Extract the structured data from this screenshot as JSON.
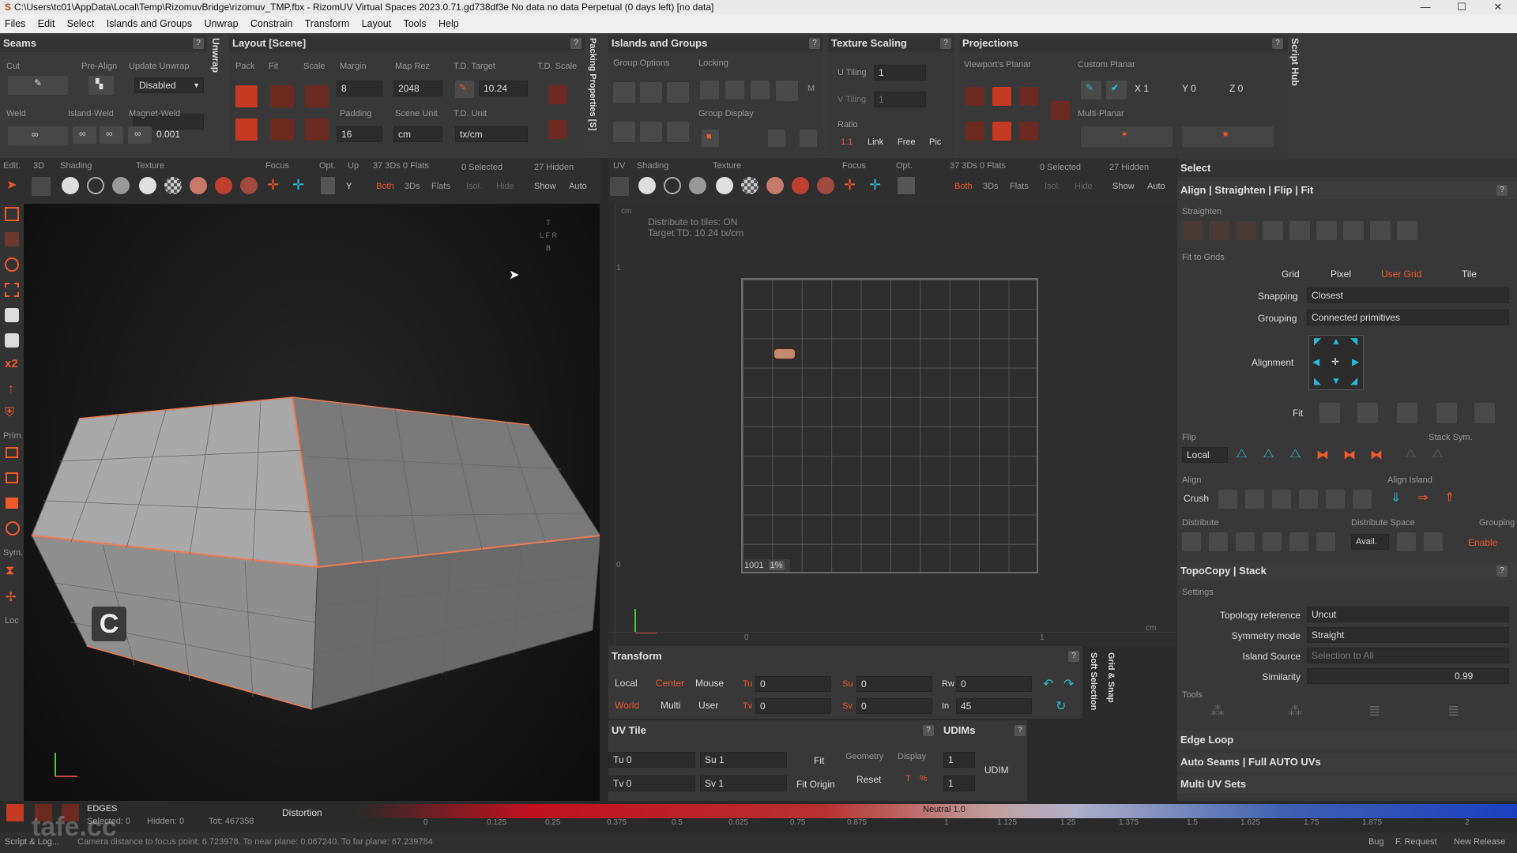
{
  "window": {
    "title": "C:\\Users\\tc01\\AppData\\Local\\Temp\\RizomuvBridge\\rizomuv_TMP.fbx - RizomUV  Virtual Spaces 2023.0.71.gd738df3e No data no data Perpetual  (0 days left) [no data]",
    "minimize": "—",
    "maximize": "☐",
    "close": "✕"
  },
  "menu": [
    "Files",
    "Edit",
    "Select",
    "Islands and Groups",
    "Unwrap",
    "Constrain",
    "Transform",
    "Layout",
    "Tools",
    "Help"
  ],
  "seams": {
    "title": "Seams",
    "help": "?",
    "cut": "Cut",
    "pre_align": "Pre-Align",
    "update_unwrap": "Update Unwrap",
    "update_value": "Disabled",
    "weld": "Weld",
    "island_weld": "Island-Weld",
    "magnet_weld": "Magnet-Weld",
    "magnet_value": "0.001"
  },
  "unwrap_tab": "Unwrap",
  "layout": {
    "title": "Layout [Scene]",
    "help": "?",
    "pack": "Pack",
    "fit": "Fit",
    "scale": "Scale",
    "margin": "Margin",
    "margin_value": "8",
    "map_rez": "Map Rez",
    "map_rez_value": "2048",
    "td_target": "T.D. Target",
    "td_target_value": "10.24",
    "td_scale": "T.D. Scale",
    "padding": "Padding",
    "padding_value": "16",
    "scene_unit": "Scene Unit",
    "scene_unit_value": "cm",
    "td_unit": "T.D. Unit",
    "td_unit_value": "tx/cm"
  },
  "packing_tab": "Packing Properties [S]",
  "islands": {
    "title": "Islands and Groups",
    "help": "?",
    "group_options": "Group Options",
    "locking": "Locking",
    "group_display": "Group Display",
    "m": "M"
  },
  "texture_scaling": {
    "title": "Texture Scaling",
    "help": "?",
    "u_tiling": "U Tiling",
    "u_value": "1",
    "v_tiling": "V Tiling",
    "v_value": "1",
    "ratio": "Ratio",
    "r11": "1:1",
    "link": "Link",
    "free": "Free",
    "pic": "Pic"
  },
  "projections": {
    "title": "Projections",
    "help": "?",
    "viewport_planar": "Viewport's Planar",
    "custom_planar": "Custom Planar",
    "multi_planar": "Multi-Planar",
    "x": "X 1",
    "y": "Y 0",
    "z": "Z 0"
  },
  "script_hub": "Script Hub",
  "vp3d_toolbar": {
    "edit": "Edit.",
    "three_d": "3D",
    "shading": "Shading",
    "texture": "Texture",
    "focus": "Focus",
    "opt": "Opt.",
    "up": "Up",
    "y": "Y",
    "stats": "37 3Ds 0 Flats",
    "selected": "0 Selected",
    "hidden": "27 Hidden",
    "both": "Both",
    "threeds": "3Ds",
    "flats": "Flats",
    "isol": "Isol.",
    "hide": "Hide",
    "show": "Show",
    "auto": "Auto"
  },
  "uv_toolbar": {
    "uv": "UV",
    "shading": "Shading",
    "texture": "Texture",
    "focus": "Focus",
    "opt": "Opt.",
    "stats": "37 3Ds 0 Flats",
    "selected": "0 Selected",
    "hidden": "27 Hidden",
    "both": "Both",
    "threeds": "3Ds",
    "flats": "Flats",
    "isol": "Isol.",
    "hide": "Hide",
    "show": "Show",
    "auto": "Auto"
  },
  "left_tools": {
    "prim": "Prim.",
    "sym": "Sym.",
    "loc": "Loc",
    "x2": "x2"
  },
  "viewport3d": {
    "cube": [
      "T",
      "L",
      "F",
      "R",
      "B"
    ],
    "corner_label": "C"
  },
  "uv_view": {
    "unit_top": "cm",
    "info1": "Distribute to tiles: ON",
    "info2": "Target TD: 10.24 tx/cm",
    "tile_label": "1001",
    "tile_pct": "1%",
    "ruler_1": "1",
    "ruler_0": "0",
    "bottom_0": "0",
    "bottom_1": "1",
    "bottom_cm": "cm"
  },
  "select_panel": {
    "title": "Select",
    "align_title": "Align | Straighten | Flip | Fit",
    "help": "?",
    "straighten": "Straighten",
    "fit_to_grids": "Fit to Grids",
    "grid": "Grid",
    "pixel": "Pixel",
    "user_grid": "User Grid",
    "tile": "Tile",
    "snapping": "Snapping",
    "snapping_value": "Closest",
    "grouping": "Grouping",
    "grouping_value": "Connected primitives",
    "alignment": "Alignment",
    "fit": "Fit",
    "flip": "Flip",
    "stack_sym": "Stack Sym.",
    "local": "Local",
    "align": "Align",
    "align_island": "Align Island",
    "crush": "Crush",
    "distribute": "Distribute",
    "distribute_space": "Distribute Space",
    "grouping2": "Grouping",
    "avail": "Avail.",
    "enable": "Enable"
  },
  "topocopy": {
    "title": "TopoCopy | Stack",
    "help": "?",
    "settings": "Settings",
    "topology_reference": "Topology reference",
    "topology_value": "Uncut",
    "symmetry_mode": "Symmetry mode",
    "symmetry_value": "Straight",
    "island_source": "Island Source",
    "island_value": "Selection to All",
    "similarity": "Similarity",
    "similarity_value": "0.99",
    "tools": "Tools"
  },
  "collapsed": {
    "edge_loop": "Edge Loop",
    "auto_seams": "Auto Seams | Full AUTO UVs",
    "multi_uv": "Multi UV Sets"
  },
  "transform": {
    "title": "Transform",
    "help": "?",
    "local": "Local",
    "center": "Center",
    "mouse": "Mouse",
    "world": "World",
    "multi": "Multi",
    "user": "User",
    "tu": "Tu",
    "tu_value": "0",
    "tv": "Tv",
    "tv_value": "0",
    "su": "Su",
    "su_value": "0",
    "sv": "Sv",
    "sv_value": "0",
    "rw": "Rw",
    "rw_value": "0",
    "in": "In",
    "in_value": "45"
  },
  "soft_selection": "Soft Selection",
  "grid_snap": "Grid & Snap",
  "uvtile": {
    "title": "UV Tile",
    "help": "?",
    "tu": "Tu 0",
    "tv": "Tv 0",
    "su": "Su 1",
    "sv": "Sv 1",
    "fit": "Fit",
    "fit_origin": "Fit Origin",
    "geometry": "Geometry",
    "display": "Display",
    "reset": "Reset",
    "t": "T",
    "pct": "%"
  },
  "udims": {
    "title": "UDIMs",
    "help": "?",
    "v1": "1",
    "v2": "1",
    "udim": "UDIM"
  },
  "status": {
    "mode": "EDGES",
    "selected": "Selected: 0",
    "hidden": "Hidden: 0",
    "total": "Tot: 467358",
    "distortion": "Distortion",
    "neutral": "Neutral 1.0",
    "scale": [
      "0",
      "0.125",
      "0.25",
      "0.375",
      "0.5",
      "0.625",
      "0.75",
      "0.875",
      "1",
      "1.125",
      "1.25",
      "1.375",
      "1.5",
      "1.625",
      "1.75",
      "1.875",
      "2"
    ]
  },
  "footer": {
    "script_log": "Script & Log...",
    "camera": "Camera distance to focus point: 6.723978. To near plane: 0.067240. To far plane: 67.239784",
    "bug": "Bug",
    "feature": "F. Request",
    "release": "New Release",
    "watermark": "tafe.cc"
  }
}
